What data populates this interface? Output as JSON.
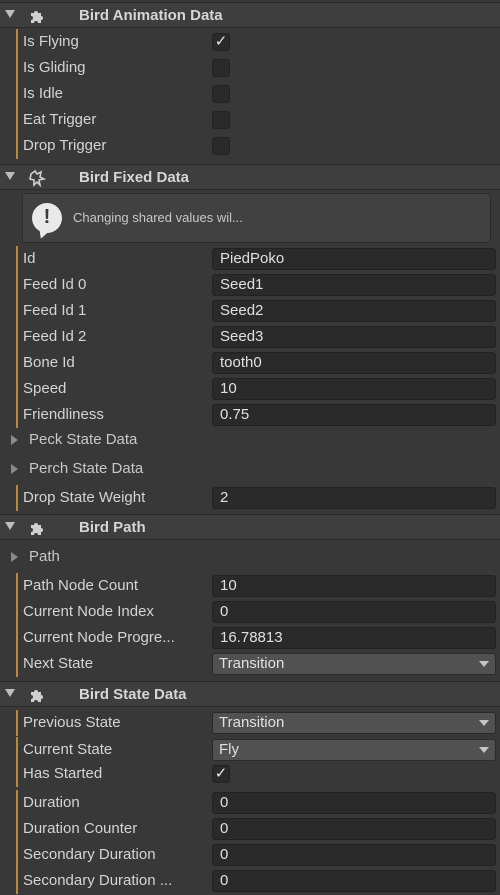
{
  "sections": {
    "animation": {
      "title": "Bird Animation Data",
      "fields": {
        "is_flying": {
          "label": "Is Flying",
          "checked": true,
          "mark": "✓"
        },
        "is_gliding": {
          "label": "Is Gliding",
          "checked": false
        },
        "is_idle": {
          "label": "Is Idle",
          "checked": false
        },
        "eat_trigger": {
          "label": "Eat Trigger",
          "checked": false
        },
        "drop_trigger": {
          "label": "Drop Trigger",
          "checked": false
        }
      }
    },
    "fixed": {
      "title": "Bird Fixed Data",
      "help_text": "Changing shared values wil...",
      "help_icon_glyph": "!",
      "fields": {
        "id": {
          "label": "Id",
          "value": "PiedPoko"
        },
        "feed_id_0": {
          "label": "Feed Id 0",
          "value": "Seed1"
        },
        "feed_id_1": {
          "label": "Feed Id 1",
          "value": "Seed2"
        },
        "feed_id_2": {
          "label": "Feed Id 2",
          "value": "Seed3"
        },
        "bone_id": {
          "label": "Bone Id",
          "value": "tooth0"
        },
        "speed": {
          "label": "Speed",
          "value": "10"
        },
        "friendliness": {
          "label": "Friendliness",
          "value": "0.75"
        },
        "drop_state_weight": {
          "label": "Drop State Weight",
          "value": "2"
        }
      },
      "foldouts": {
        "peck": "Peck State Data",
        "perch": "Perch State Data"
      }
    },
    "path": {
      "title": "Bird Path",
      "foldout": "Path",
      "fields": {
        "path_node_count": {
          "label": "Path Node Count",
          "value": "10"
        },
        "current_node_index": {
          "label": "Current Node Index",
          "value": "0"
        },
        "current_node_progress": {
          "label": "Current Node Progre...",
          "value": "16.78813"
        },
        "next_state": {
          "label": "Next State",
          "value": "Transition"
        }
      }
    },
    "state": {
      "title": "Bird State Data",
      "fields": {
        "previous_state": {
          "label": "Previous State",
          "value": "Transition"
        },
        "current_state": {
          "label": "Current State",
          "value": "Fly"
        },
        "has_started": {
          "label": "Has Started",
          "checked": true,
          "mark": "✓"
        },
        "duration": {
          "label": "Duration",
          "value": "0"
        },
        "duration_counter": {
          "label": "Duration Counter",
          "value": "0"
        },
        "secondary_duration": {
          "label": "Secondary Duration",
          "value": "0"
        },
        "secondary_duration_counter": {
          "label": "Secondary Duration ...",
          "value": "0"
        }
      }
    }
  },
  "colors": {
    "background": "#383838",
    "header": "#3e3e3e",
    "field": "#2a2a2a",
    "override_bar": "#b9893a"
  },
  "icons": {
    "component": "puzzle-piece-icon",
    "fixed_component": "bird-script-icon",
    "help": "info-bubble-icon",
    "fold": "foldout-triangle-icon",
    "dropdown": "chevron-down-icon",
    "check": "checkmark-icon"
  }
}
